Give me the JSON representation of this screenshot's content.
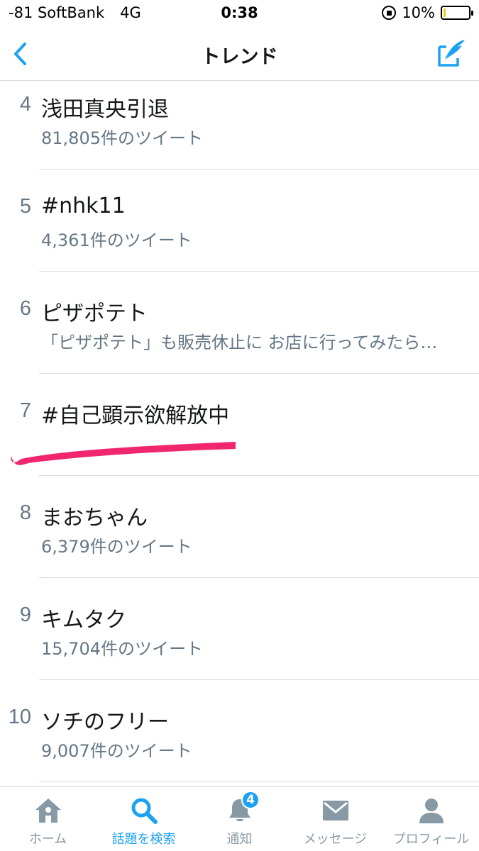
{
  "status_bar": {
    "carrier": "-81 SoftBank",
    "network": "4G",
    "time": "0:38",
    "battery_text": "10%",
    "battery_level": 0.1
  },
  "nav": {
    "title": "トレンド",
    "back_icon": "chevron-left-icon",
    "compose_icon": "compose-icon"
  },
  "trends": [
    {
      "rank": "4",
      "name": "浅田真央引退",
      "sub": "81,805件のツイート"
    },
    {
      "rank": "5",
      "name": "#nhk11",
      "sub": "4,361件のツイート"
    },
    {
      "rank": "6",
      "name": "ピザポテト",
      "sub": "「ピザポテト」も販売休止に お店に行ってみたら…"
    },
    {
      "rank": "7",
      "name": "#自己顕示欲解放中",
      "sub": ""
    },
    {
      "rank": "8",
      "name": "まおちゃん",
      "sub": "6,379件のツイート"
    },
    {
      "rank": "9",
      "name": "キムタク",
      "sub": "15,704件のツイート"
    },
    {
      "rank": "10",
      "name": "ソチのフリー",
      "sub": "9,007件のツイート"
    }
  ],
  "tabs": [
    {
      "label": "ホーム",
      "icon": "home-icon"
    },
    {
      "label": "話題を検索",
      "icon": "search-icon"
    },
    {
      "label": "通知",
      "icon": "bell-icon",
      "badge": "4"
    },
    {
      "label": "メッセージ",
      "icon": "envelope-icon"
    },
    {
      "label": "プロフィール",
      "icon": "person-icon"
    }
  ],
  "colors": {
    "accent": "#1da1f2",
    "highlight_stroke": "#f0276e",
    "muted": "#657786"
  }
}
